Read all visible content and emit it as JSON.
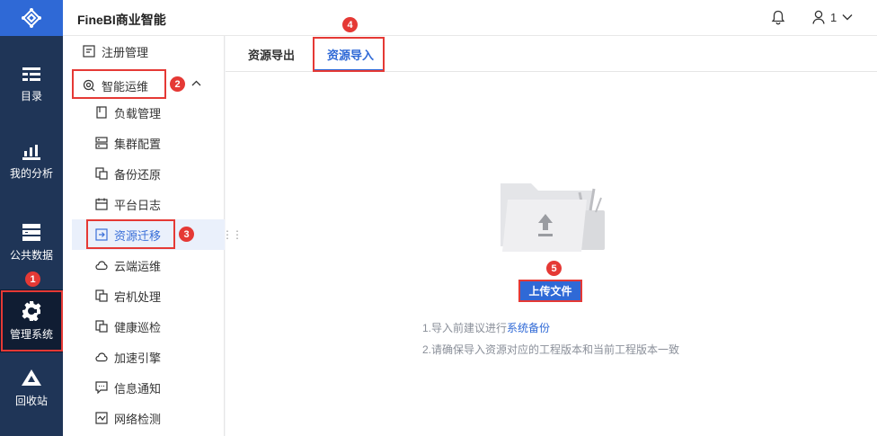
{
  "app": {
    "title": "FineBI商业智能"
  },
  "header": {
    "user_name": "1"
  },
  "leftnav": {
    "items": [
      {
        "label": "目录",
        "icon": "catalog-icon"
      },
      {
        "label": "我的分析",
        "icon": "chart-icon"
      },
      {
        "label": "公共数据",
        "icon": "database-icon"
      },
      {
        "label": "管理系统",
        "icon": "gear-icon"
      },
      {
        "label": "回收站",
        "icon": "recycle-icon"
      }
    ]
  },
  "sidebar": {
    "items": [
      {
        "label": "注册管理"
      },
      {
        "label": "智能运维"
      },
      {
        "label": "负载管理"
      },
      {
        "label": "集群配置"
      },
      {
        "label": "备份还原"
      },
      {
        "label": "平台日志"
      },
      {
        "label": "资源迁移"
      },
      {
        "label": "云端运维"
      },
      {
        "label": "宕机处理"
      },
      {
        "label": "健康巡检"
      },
      {
        "label": "加速引擎"
      },
      {
        "label": "信息通知"
      },
      {
        "label": "网络检测"
      }
    ]
  },
  "tabs": [
    {
      "label": "资源导出"
    },
    {
      "label": "资源导入"
    }
  ],
  "main": {
    "upload_label": "上传文件",
    "tip1_prefix": "1.导入前建议进行",
    "tip1_link": "系统备份",
    "tip2": "2.请确保导入资源对应的工程版本和当前工程版本一致"
  },
  "badges": [
    "1",
    "2",
    "3",
    "4",
    "5"
  ],
  "colors": {
    "accent": "#2f69d6",
    "nav_bg": "#1f3557",
    "highlight": "#e53935"
  }
}
